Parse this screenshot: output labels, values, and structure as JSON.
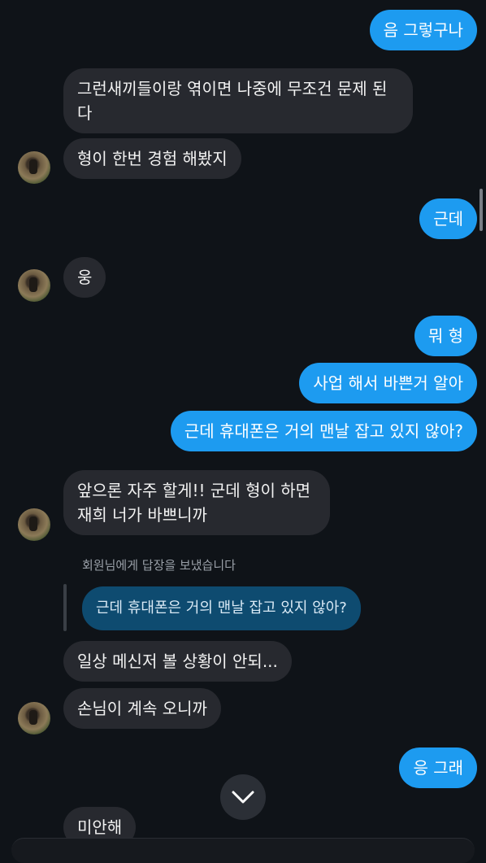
{
  "messages": [
    {
      "side": "out",
      "text": "음 그렇구나"
    },
    {
      "side": "in",
      "text": "그런새끼들이랑 엮이면 나중에 무조건 문제 된다"
    },
    {
      "side": "in",
      "text": "형이 한번 경험 해봤지"
    },
    {
      "side": "out",
      "text": "근데"
    },
    {
      "side": "in",
      "text": "웅"
    },
    {
      "side": "out",
      "text": "뭐 형"
    },
    {
      "side": "out",
      "text": "사업 해서 바쁜거 알아"
    },
    {
      "side": "out",
      "text": "근데 휴대폰은 거의 맨날 잡고 있지 않아?"
    },
    {
      "side": "in",
      "text": "앞으론 자주 할게!! 군데 형이 하면 재희 너가 바쁘니까"
    },
    {
      "side": "in",
      "text": "일상 메신저 볼 상황이 안되..."
    },
    {
      "side": "in",
      "text": "손님이 계속 오니까"
    },
    {
      "side": "out",
      "text": "응 그래"
    },
    {
      "side": "in",
      "text": "미안해"
    }
  ],
  "reply": {
    "note": "회원님에게 답장을 보냈습니다",
    "quoted": "근데 휴대폰은 거의 맨날 잡고 있지 않아?"
  },
  "icons": {
    "avatar": "avatar",
    "scroll_down": "chevron-down-icon"
  },
  "colors": {
    "background": "#0f1318",
    "incoming_bubble": "#27292f",
    "outgoing_bubble": "#1d9bf0",
    "quoted_bubble": "#0e4b70"
  }
}
